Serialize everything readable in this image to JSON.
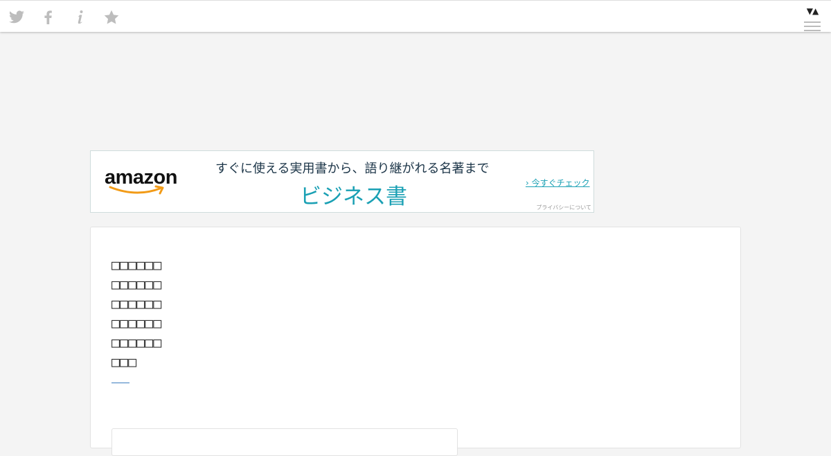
{
  "share_bar": {
    "icons": [
      "twitter-icon",
      "facebook-icon",
      "info-icon",
      "star-icon"
    ],
    "icon_color": "#bdbdbd",
    "toggle": "▼▲"
  },
  "ad": {
    "logo": "amazon",
    "tagline": "すぐに使える実用書から、語り継がれる名著まで",
    "headline": "ビジネス書",
    "cta": "› 今すぐチェック",
    "privacy": "プライバシーについて",
    "colors": {
      "tagline": "#1c3548",
      "headline": "#1aa0b4",
      "smile": "#f29b17"
    }
  },
  "article": {
    "title": "□□□□□□\n□□□□□□\n□□□□□□\n□□□□□□\n□□□□□□\n□□□",
    "accent_color": "#3a7bbf"
  }
}
